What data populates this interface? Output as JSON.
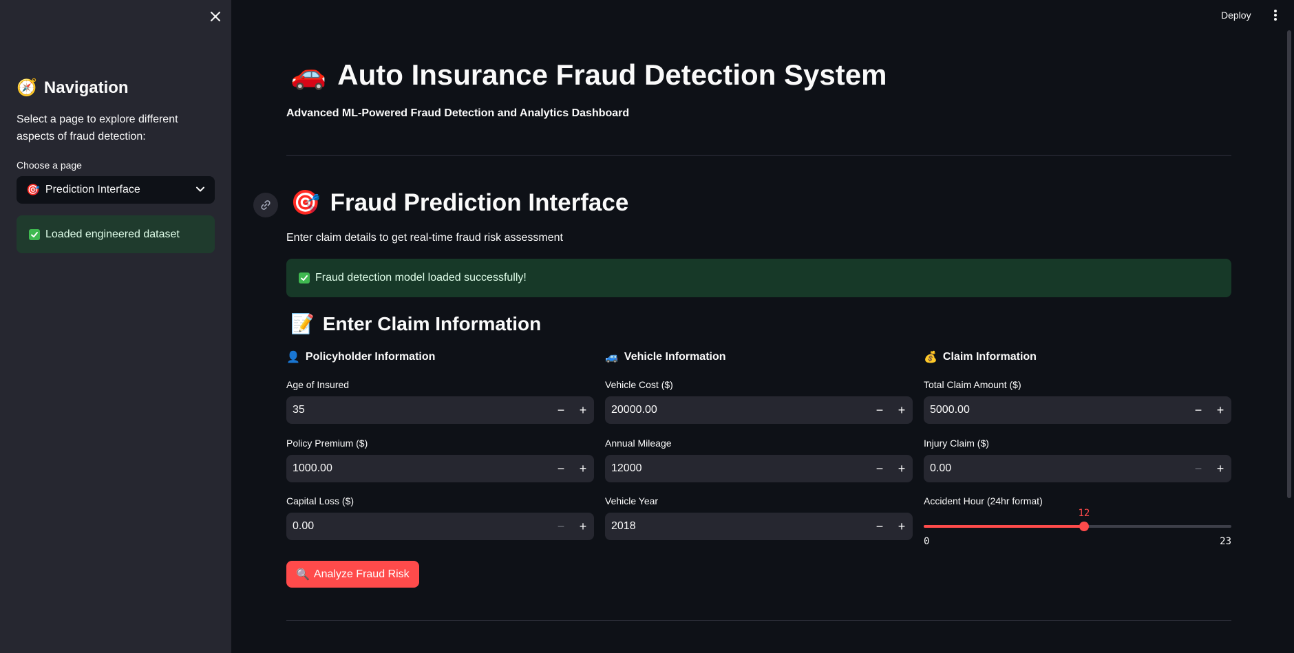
{
  "sidebar": {
    "title_icon": "🧭",
    "title": "Navigation",
    "description": "Select a page to explore different aspects of fraud detection:",
    "select_label": "Choose a page",
    "select_icon": "🎯",
    "select_value": "Prediction Interface",
    "success_text": "Loaded engineered dataset"
  },
  "header": {
    "deploy_label": "Deploy"
  },
  "main": {
    "title_icon": "🚗",
    "title": "Auto Insurance Fraud Detection System",
    "subtitle": "Advanced ML-Powered Fraud Detection and Analytics Dashboard",
    "section_icon": "🎯",
    "section_title": "Fraud Prediction Interface",
    "section_caption": "Enter claim details to get real-time fraud risk assessment",
    "model_success": "Fraud detection model loaded successfully!",
    "form_icon": "📝",
    "form_title": "Enter Claim Information",
    "columns": [
      {
        "icon": "👤",
        "heading": "Policyholder Information",
        "fields": [
          {
            "label": "Age of Insured",
            "value": "35"
          },
          {
            "label": "Policy Premium ($)",
            "value": "1000.00"
          },
          {
            "label": "Capital Loss ($)",
            "value": "0.00"
          }
        ]
      },
      {
        "icon": "🚙",
        "heading": "Vehicle Information",
        "fields": [
          {
            "label": "Vehicle Cost ($)",
            "value": "20000.00"
          },
          {
            "label": "Annual Mileage",
            "value": "12000"
          },
          {
            "label": "Vehicle Year",
            "value": "2018"
          }
        ]
      },
      {
        "icon": "💰",
        "heading": "Claim Information",
        "fields": [
          {
            "label": "Total Claim Amount ($)",
            "value": "5000.00"
          },
          {
            "label": "Injury Claim ($)",
            "value": "0.00"
          }
        ],
        "slider": {
          "label": "Accident Hour (24hr format)",
          "value": "12",
          "min": "0",
          "max": "23"
        }
      }
    ],
    "analyze_icon": "🔍",
    "analyze_label": "Analyze Fraud Risk"
  },
  "colors": {
    "background": "#0e1117",
    "sidebar": "#262730",
    "accent": "#ff4b4b",
    "success_bg": "#173928"
  },
  "icons": {
    "close": "close-icon",
    "chevron": "chevron-down-icon",
    "link": "link-icon",
    "menu": "kebab-menu-icon",
    "check": "check-icon"
  }
}
